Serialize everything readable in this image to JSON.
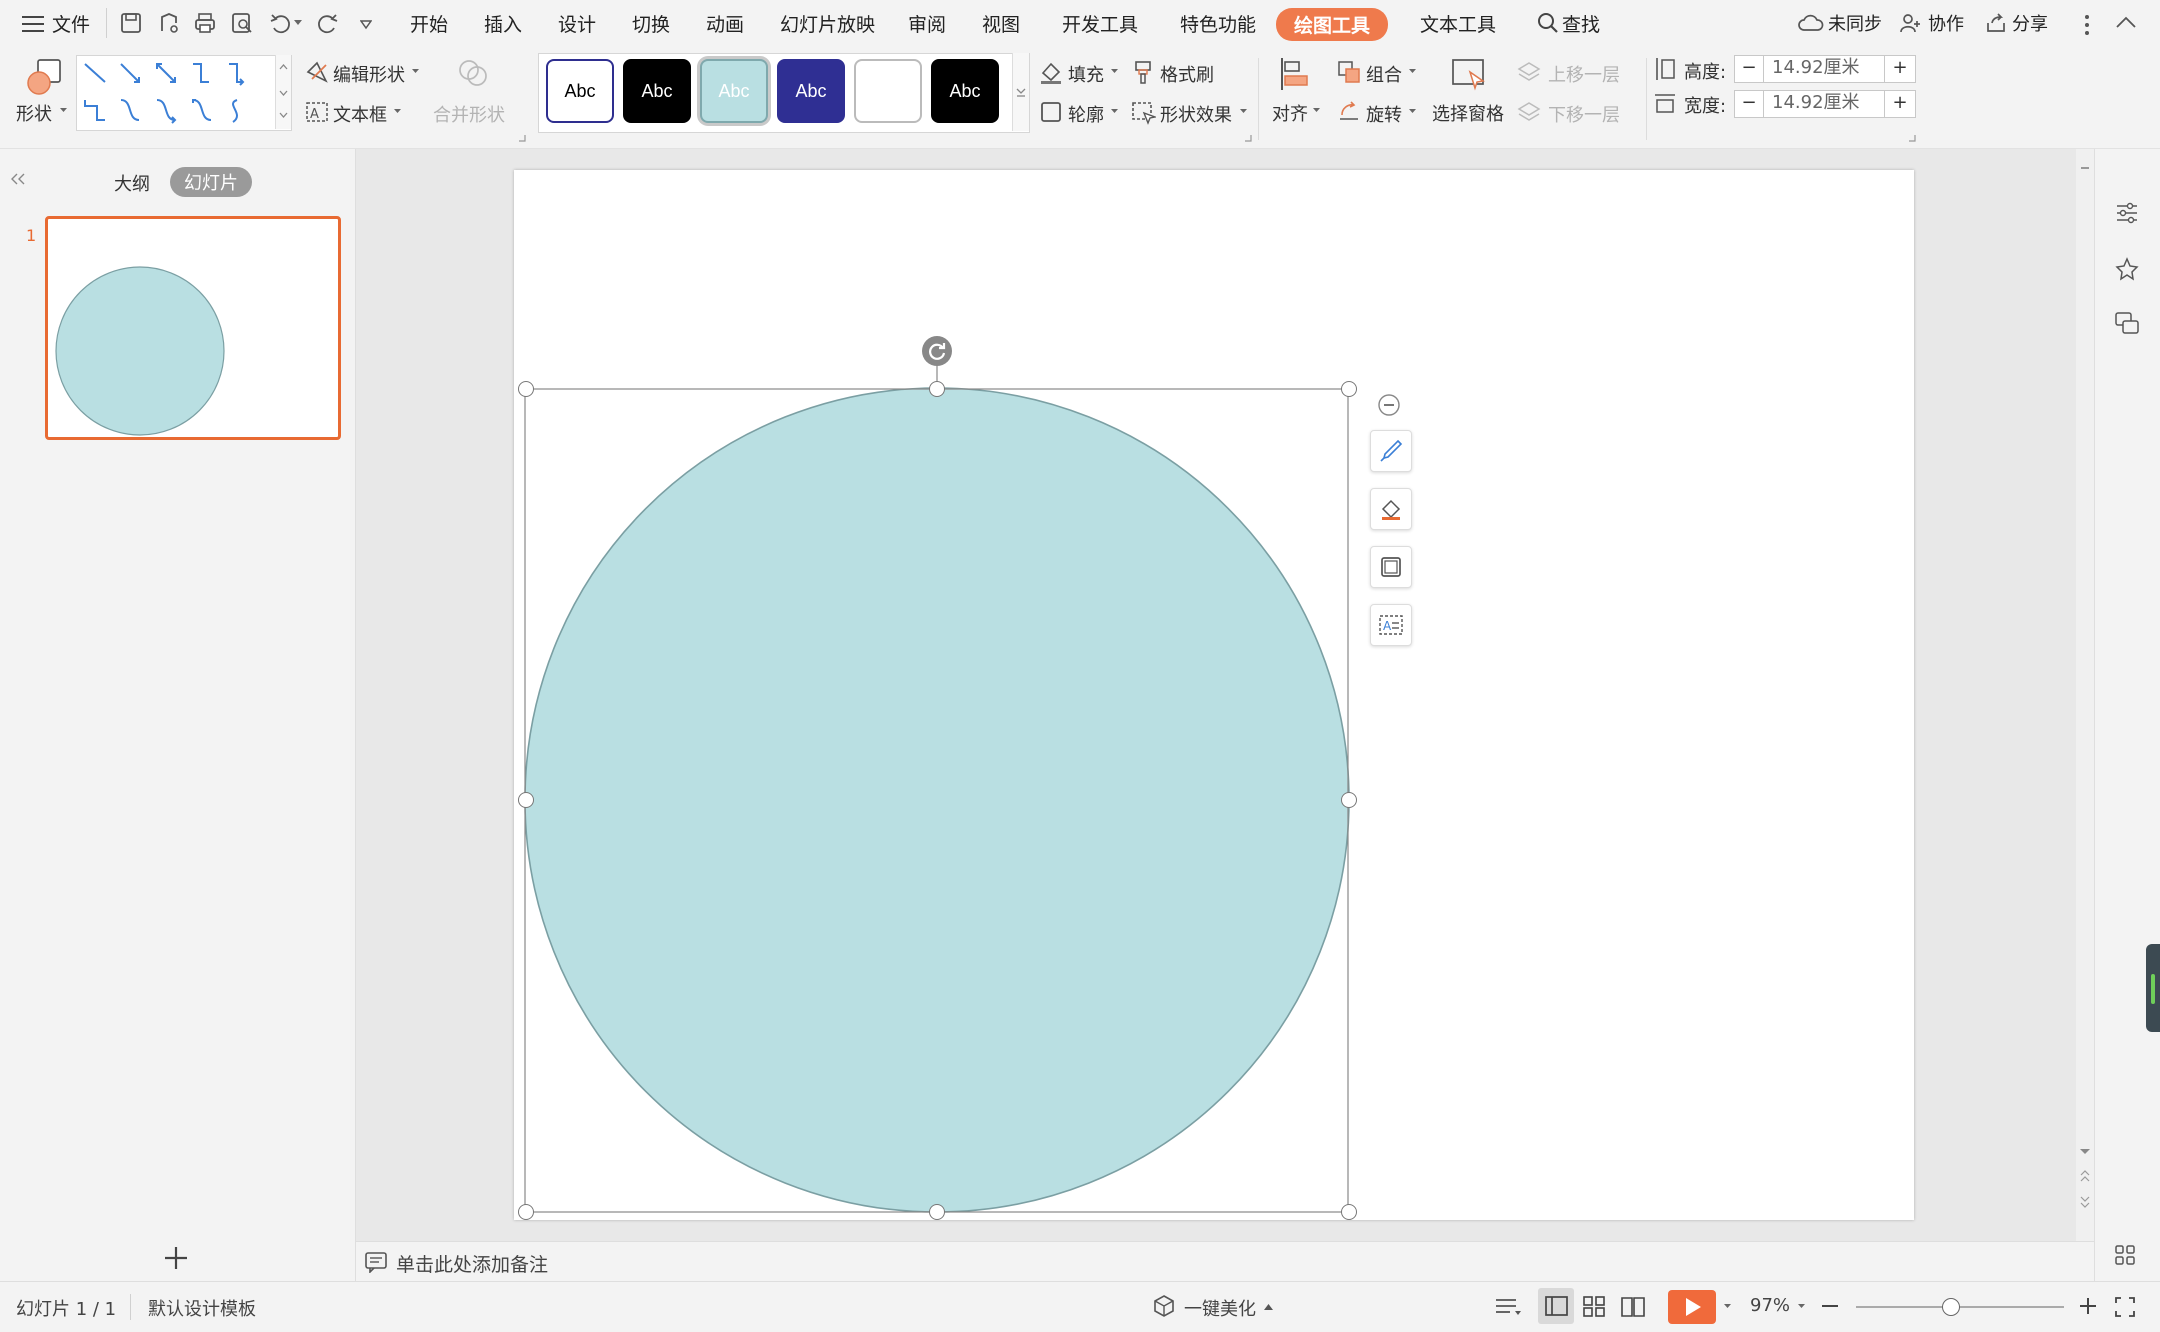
{
  "menubar": {
    "file": "文件",
    "tabs": [
      "开始",
      "插入",
      "设计",
      "切换",
      "动画",
      "幻灯片放映",
      "审阅",
      "视图",
      "开发工具",
      "特色功能",
      "绘图工具",
      "文本工具"
    ],
    "search": "查找",
    "sync": "未同步",
    "collab": "协作",
    "share": "分享"
  },
  "ribbon": {
    "shape": "形状",
    "edit_shape": "编辑形状",
    "text_box": "文本框",
    "merge_shape": "合并形状",
    "style_swatches": [
      {
        "label": "Abc",
        "bg": "#ffffff",
        "fg": "#000000",
        "border": "#2e2e8f"
      },
      {
        "label": "Abc",
        "bg": "#000000",
        "fg": "#ffffff",
        "border": "#000000"
      },
      {
        "label": "Abc",
        "bg": "#b9dfe2",
        "fg": "#ffffff",
        "border": "#7fa9ad"
      },
      {
        "label": "Abc",
        "bg": "#2f2f93",
        "fg": "#ffffff",
        "border": "#2f2f93"
      },
      {
        "label": "",
        "bg": "#ffffff",
        "fg": "#000000",
        "border": "#bbbbbb"
      },
      {
        "label": "Abc",
        "bg": "#000000",
        "fg": "#ffffff",
        "border": "#000000"
      }
    ],
    "fill": "填充",
    "format_painter": "格式刷",
    "outline": "轮廓",
    "shape_effect": "形状效果",
    "align": "对齐",
    "group": "组合",
    "rotate": "旋转",
    "selection_pane": "选择窗格",
    "bring_forward": "上移一层",
    "send_backward": "下移一层",
    "height_label": "高度:",
    "height_value": "14.92厘米",
    "width_label": "宽度:",
    "width_value": "14.92厘米"
  },
  "left_panel": {
    "outline_tab": "大纲",
    "slides_tab": "幻灯片",
    "slide_number": "1"
  },
  "notes": {
    "placeholder": "单击此处添加备注"
  },
  "status": {
    "slide_count": "幻灯片 1 / 1",
    "template": "默认设计模板",
    "beautify": "一键美化",
    "zoom": "97%"
  },
  "shape": {
    "fill": "#b9dfe2",
    "stroke": "#7b9fa3"
  },
  "colors": {
    "accent": "#ef7a4c",
    "selection_border": "#e86a32"
  }
}
